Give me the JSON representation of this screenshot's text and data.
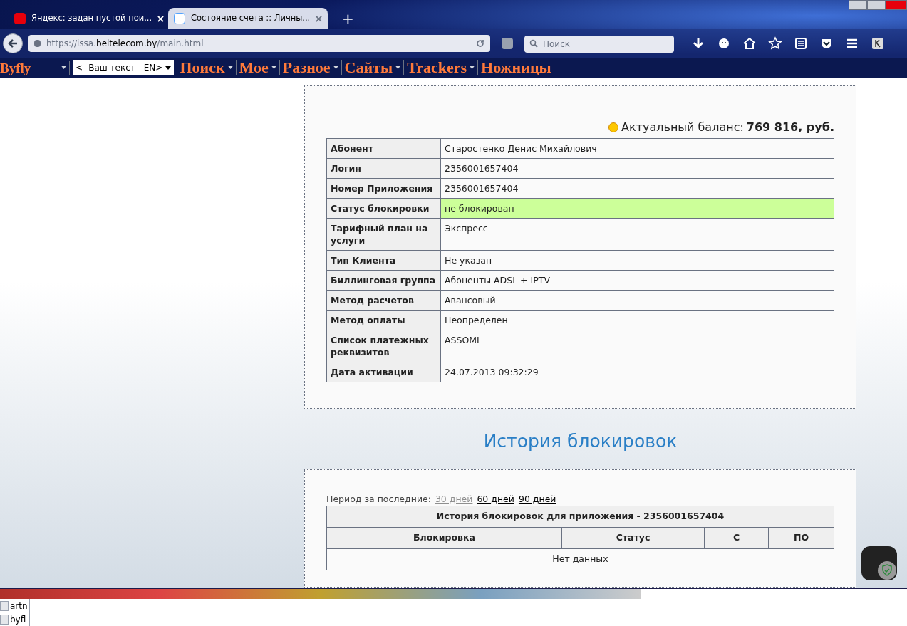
{
  "browser": {
    "tabs": [
      {
        "title": "Яндекс: задан пустой пои...",
        "selected": false
      },
      {
        "title": "Состояние счета :: Личны...",
        "selected": true
      }
    ],
    "new_tab": "+",
    "url": {
      "scheme": "https://issa.",
      "domain": "beltelecom.by",
      "path": "/main.html"
    },
    "search": {
      "placeholder": "Поиск"
    },
    "toolbar": [
      {
        "kind": "download"
      },
      {
        "kind": "chat"
      },
      {
        "kind": "home"
      },
      {
        "kind": "star"
      },
      {
        "kind": "list"
      },
      {
        "kind": "pocket"
      },
      {
        "kind": "menu"
      },
      {
        "kind": "k"
      }
    ],
    "bookmarks": [
      {
        "label": "Byfly",
        "kind": "small"
      },
      {
        "label": "<- Ваш текст - EN>",
        "kind": "select"
      },
      {
        "label": "Поиск",
        "kind": "big"
      },
      {
        "label": "Мое",
        "kind": "big"
      },
      {
        "label": "Разное",
        "kind": "big"
      },
      {
        "label": "Сайты",
        "kind": "big"
      },
      {
        "label": "Trackers",
        "kind": "big"
      },
      {
        "label": "Ножницы",
        "kind": "last"
      }
    ]
  },
  "balance": {
    "label": "Актуальный баланс:",
    "value": "769 816, руб."
  },
  "account": [
    {
      "field": "Абонент",
      "value": "Старостенко Денис Михайлович",
      "highlight": false
    },
    {
      "field": "Логин",
      "value": "2356001657404",
      "highlight": false
    },
    {
      "field": "Номер Приложения",
      "value": "2356001657404",
      "highlight": false
    },
    {
      "field": "Статус блокировки",
      "value": "не блокирован",
      "highlight": true
    },
    {
      "field": "Тарифный план на услуги",
      "value": "Экспресс",
      "highlight": false
    },
    {
      "field": "Тип Клиента",
      "value": "Не указан",
      "highlight": false
    },
    {
      "field": "Биллинговая группа",
      "value": "Абоненты ADSL + IPTV",
      "highlight": false
    },
    {
      "field": "Метод расчетов",
      "value": "Авансовый",
      "highlight": false
    },
    {
      "field": "Метод оплаты",
      "value": "Неопределен",
      "highlight": false
    },
    {
      "field": "Список платежных реквизитов",
      "value": "ASSOMI",
      "highlight": false
    },
    {
      "field": "Дата активации",
      "value": "24.07.2013 09:32:29",
      "highlight": false
    }
  ],
  "history": {
    "heading": "История блокировок",
    "period_label": "Период за последние:",
    "periods": [
      {
        "label": "30 дней",
        "selected": true
      },
      {
        "label": "60 дней",
        "selected": false
      },
      {
        "label": "90 дней",
        "selected": false
      }
    ],
    "table_title": "История блокировок для приложения - 2356001657404",
    "columns": [
      "Блокировка",
      "Статус",
      "С",
      "ПО"
    ],
    "empty": "Нет данных"
  },
  "taskbar": [
    {
      "label": "artn"
    },
    {
      "label": "byfl"
    }
  ]
}
